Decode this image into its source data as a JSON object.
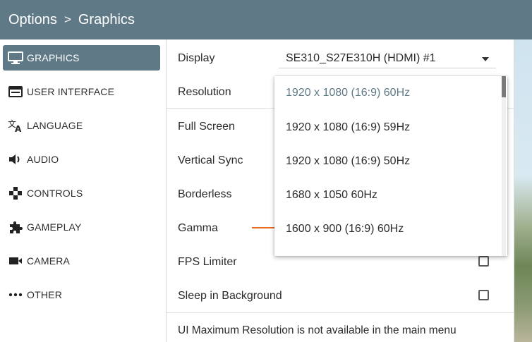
{
  "header": {
    "root": "Options",
    "separator": ">",
    "current": "Graphics"
  },
  "sidebar": {
    "items": [
      {
        "label": "GRAPHICS",
        "icon": "monitor-icon",
        "active": true
      },
      {
        "label": "USER INTERFACE",
        "icon": "window-icon",
        "active": false
      },
      {
        "label": "LANGUAGE",
        "icon": "translate-icon",
        "active": false
      },
      {
        "label": "AUDIO",
        "icon": "speaker-icon",
        "active": false
      },
      {
        "label": "CONTROLS",
        "icon": "gamepad-icon",
        "active": false
      },
      {
        "label": "GAMEPLAY",
        "icon": "puzzle-icon",
        "active": false
      },
      {
        "label": "CAMERA",
        "icon": "camera-icon",
        "active": false
      },
      {
        "label": "OTHER",
        "icon": "more-icon",
        "active": false
      }
    ]
  },
  "settings": {
    "display": {
      "label": "Display",
      "value": "SE310_S27E310H (HDMI) #1"
    },
    "resolution": {
      "label": "Resolution"
    },
    "full_screen": {
      "label": "Full Screen"
    },
    "vertical_sync": {
      "label": "Vertical Sync"
    },
    "borderless": {
      "label": "Borderless"
    },
    "gamma": {
      "label": "Gamma"
    },
    "fps_limiter": {
      "label": "FPS Limiter",
      "checked": false
    },
    "sleep_bg": {
      "label": "Sleep in Background",
      "checked": false
    },
    "note": "UI Maximum Resolution is not available in the main menu"
  },
  "resolution_dropdown": {
    "options": [
      "1920 x 1080 (16:9) 60Hz",
      "1920 x 1080 (16:9) 59Hz",
      "1920 x 1080 (16:9) 50Hz",
      "1680 x 1050 60Hz",
      "1600 x 900 (16:9) 60Hz"
    ],
    "selected_index": 0
  },
  "colors": {
    "accent": "#5f7986",
    "gamma_slider": "#e76b1f"
  }
}
